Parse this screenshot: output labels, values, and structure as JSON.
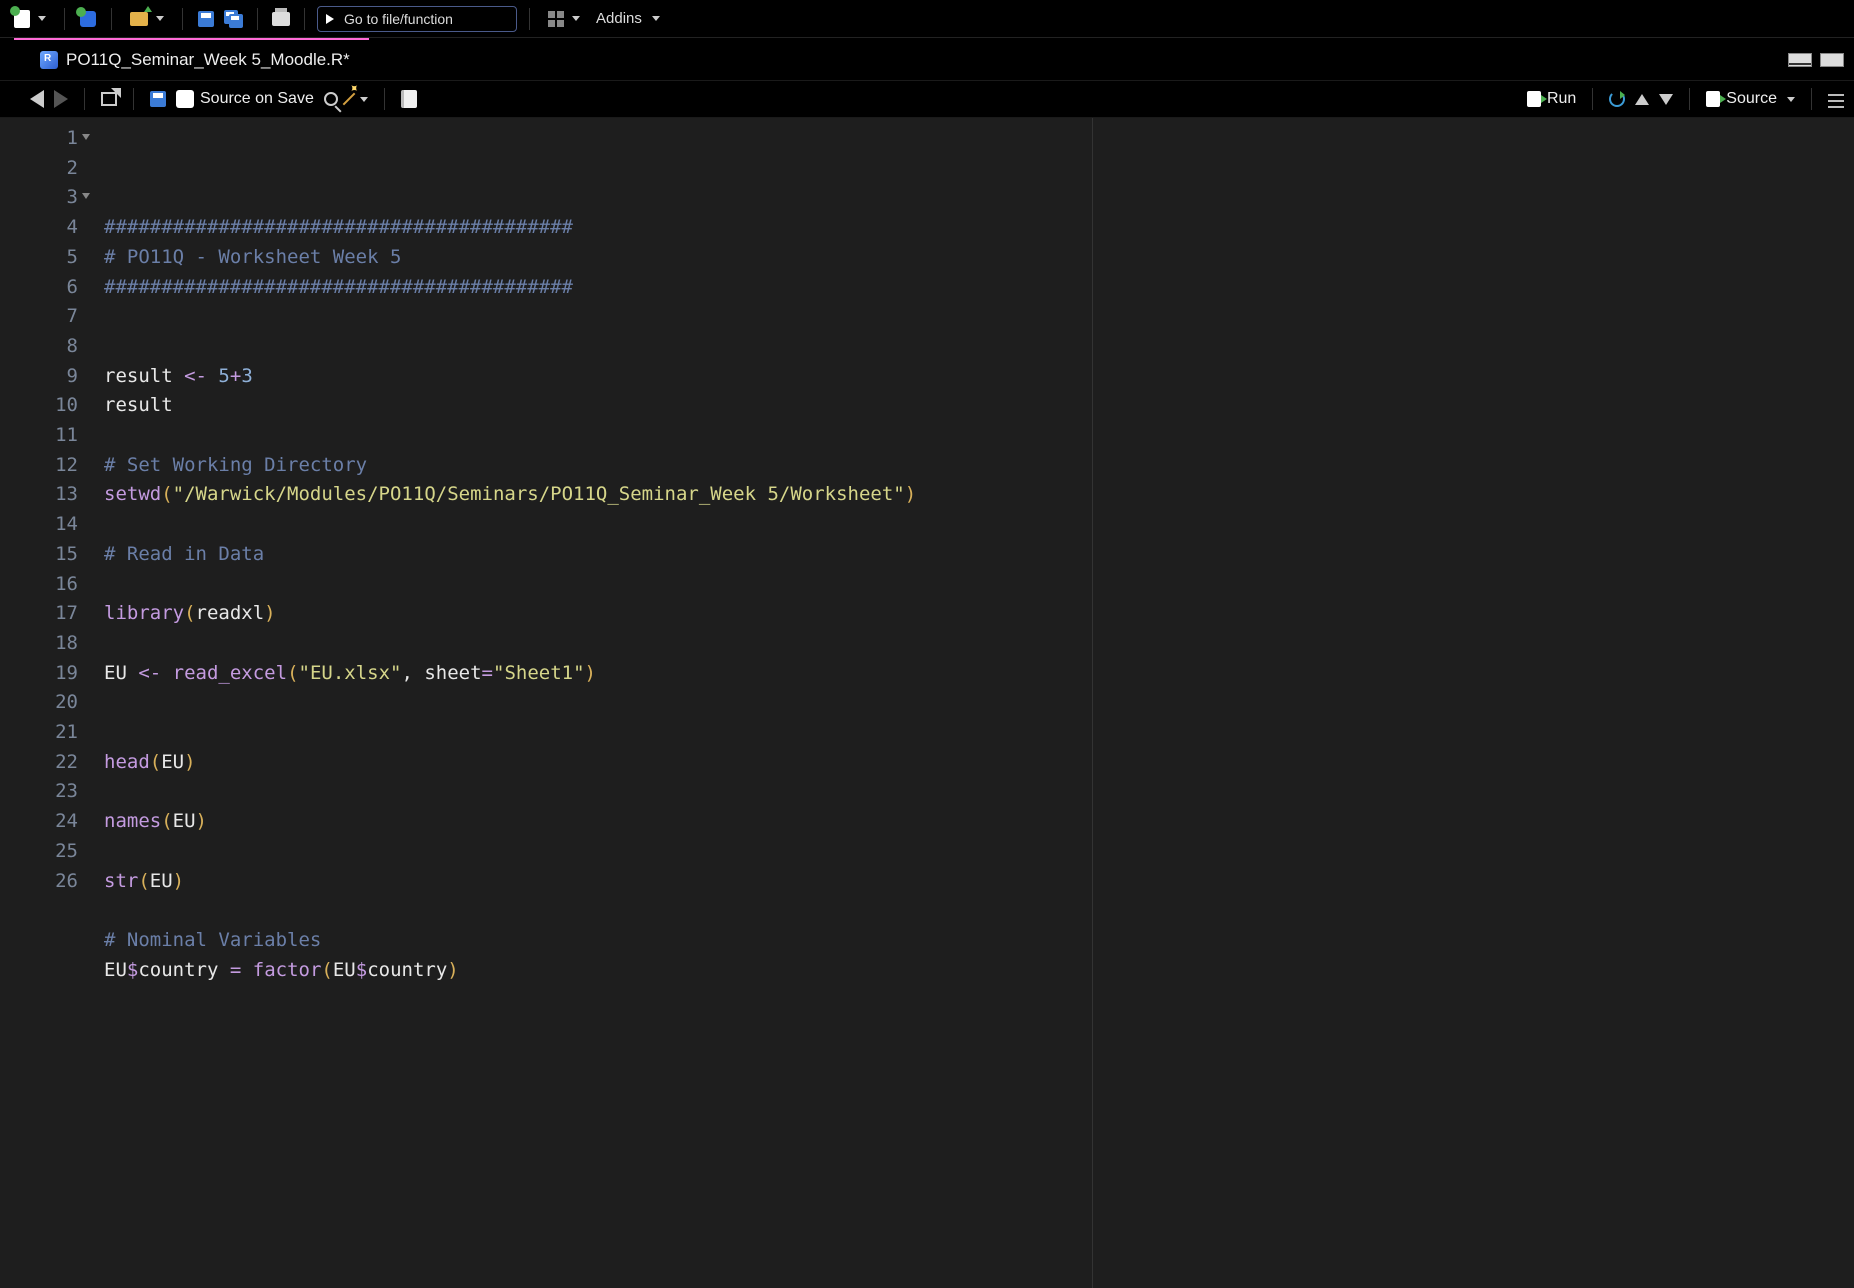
{
  "topbar": {
    "goto_placeholder": "Go to file/function",
    "addins_label": "Addins"
  },
  "tab": {
    "filename": "PO11Q_Seminar_Week 5_Moodle.R*"
  },
  "editor_toolbar": {
    "source_on_save": "Source on Save",
    "run": "Run",
    "source": "Source"
  },
  "code": {
    "lines": [
      {
        "n": 1,
        "fold": true,
        "segs": [
          {
            "c": "tok-comment",
            "t": "#########################################"
          }
        ]
      },
      {
        "n": 2,
        "segs": [
          {
            "c": "tok-comment",
            "t": "# PO11Q - Worksheet Week 5"
          }
        ]
      },
      {
        "n": 3,
        "fold": true,
        "segs": [
          {
            "c": "tok-comment",
            "t": "#########################################"
          }
        ]
      },
      {
        "n": 4,
        "segs": []
      },
      {
        "n": 5,
        "segs": []
      },
      {
        "n": 6,
        "segs": [
          {
            "c": "tok-ident",
            "t": "result "
          },
          {
            "c": "tok-assign",
            "t": "<-"
          },
          {
            "c": "tok-ident",
            "t": " "
          },
          {
            "c": "tok-num",
            "t": "5"
          },
          {
            "c": "tok-assign",
            "t": "+"
          },
          {
            "c": "tok-num",
            "t": "3"
          }
        ]
      },
      {
        "n": 7,
        "segs": [
          {
            "c": "tok-ident",
            "t": "result"
          }
        ]
      },
      {
        "n": 8,
        "segs": []
      },
      {
        "n": 9,
        "segs": [
          {
            "c": "tok-comment",
            "t": "# Set Working Directory"
          }
        ]
      },
      {
        "n": 10,
        "segs": [
          {
            "c": "tok-func",
            "t": "setwd"
          },
          {
            "c": "tok-paren",
            "t": "("
          },
          {
            "c": "tok-string",
            "t": "\"/Warwick/Modules/PO11Q/Seminars/PO11Q_Seminar_Week 5/Worksheet\""
          },
          {
            "c": "tok-paren",
            "t": ")"
          }
        ]
      },
      {
        "n": 11,
        "segs": []
      },
      {
        "n": 12,
        "segs": [
          {
            "c": "tok-comment",
            "t": "# Read in Data"
          }
        ]
      },
      {
        "n": 13,
        "segs": []
      },
      {
        "n": 14,
        "segs": [
          {
            "c": "tok-func",
            "t": "library"
          },
          {
            "c": "tok-paren",
            "t": "("
          },
          {
            "c": "tok-ident",
            "t": "readxl"
          },
          {
            "c": "tok-paren",
            "t": ")"
          }
        ]
      },
      {
        "n": 15,
        "segs": []
      },
      {
        "n": 16,
        "segs": [
          {
            "c": "tok-ident",
            "t": "EU "
          },
          {
            "c": "tok-assign",
            "t": "<-"
          },
          {
            "c": "tok-ident",
            "t": " "
          },
          {
            "c": "tok-func",
            "t": "read_excel"
          },
          {
            "c": "tok-paren",
            "t": "("
          },
          {
            "c": "tok-string",
            "t": "\"EU.xlsx\""
          },
          {
            "c": "tok-ident",
            "t": ", sheet"
          },
          {
            "c": "tok-eq",
            "t": "="
          },
          {
            "c": "tok-string",
            "t": "\"Sheet1\""
          },
          {
            "c": "tok-paren",
            "t": ")"
          }
        ]
      },
      {
        "n": 17,
        "segs": []
      },
      {
        "n": 18,
        "segs": []
      },
      {
        "n": 19,
        "segs": [
          {
            "c": "tok-func",
            "t": "head"
          },
          {
            "c": "tok-paren",
            "t": "("
          },
          {
            "c": "tok-ident",
            "t": "EU"
          },
          {
            "c": "tok-paren",
            "t": ")"
          }
        ]
      },
      {
        "n": 20,
        "segs": []
      },
      {
        "n": 21,
        "segs": [
          {
            "c": "tok-func",
            "t": "names"
          },
          {
            "c": "tok-paren",
            "t": "("
          },
          {
            "c": "tok-ident",
            "t": "EU"
          },
          {
            "c": "tok-paren",
            "t": ")"
          }
        ]
      },
      {
        "n": 22,
        "segs": []
      },
      {
        "n": 23,
        "segs": [
          {
            "c": "tok-func",
            "t": "str"
          },
          {
            "c": "tok-paren",
            "t": "("
          },
          {
            "c": "tok-ident",
            "t": "EU"
          },
          {
            "c": "tok-paren",
            "t": ")"
          }
        ]
      },
      {
        "n": 24,
        "segs": []
      },
      {
        "n": 25,
        "segs": [
          {
            "c": "tok-comment",
            "t": "# Nominal Variables"
          }
        ]
      },
      {
        "n": 26,
        "segs": [
          {
            "c": "tok-ident",
            "t": "EU"
          },
          {
            "c": "tok-dollar",
            "t": "$"
          },
          {
            "c": "tok-ident",
            "t": "country "
          },
          {
            "c": "tok-eq",
            "t": "="
          },
          {
            "c": "tok-ident",
            "t": " "
          },
          {
            "c": "tok-func",
            "t": "factor"
          },
          {
            "c": "tok-paren",
            "t": "("
          },
          {
            "c": "tok-ident",
            "t": "EU"
          },
          {
            "c": "tok-dollar",
            "t": "$"
          },
          {
            "c": "tok-ident",
            "t": "country"
          },
          {
            "c": "tok-paren",
            "t": ")"
          }
        ]
      }
    ]
  }
}
